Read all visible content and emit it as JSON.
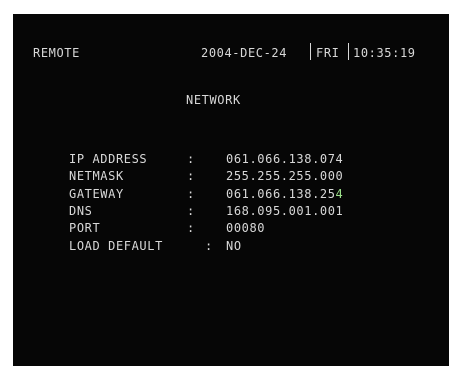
{
  "header": {
    "mode": "REMOTE",
    "date": "2004-DEC-24",
    "day": "FRI",
    "time": "10:35:19"
  },
  "page": {
    "title": "NETWORK"
  },
  "fields": [
    {
      "label": "IP ADDRESS",
      "separator": ":",
      "value": "061.066.138.074"
    },
    {
      "label": "NETMASK",
      "separator": ":",
      "value": "255.255.255.000"
    },
    {
      "label": "GATEWAY",
      "separator": ":",
      "value_main": "061.066.138.25",
      "value_last": "4"
    },
    {
      "label": "DNS",
      "separator": ":",
      "value": "168.095.001.001"
    },
    {
      "label": "PORT",
      "separator": ":",
      "value": "00080"
    },
    {
      "label": "LOAD DEFAULT",
      "separator": ":",
      "value": "NO"
    }
  ],
  "colors": {
    "screen_background": "#060606",
    "text": "#d8d8d8",
    "highlight": "#9be08a"
  }
}
